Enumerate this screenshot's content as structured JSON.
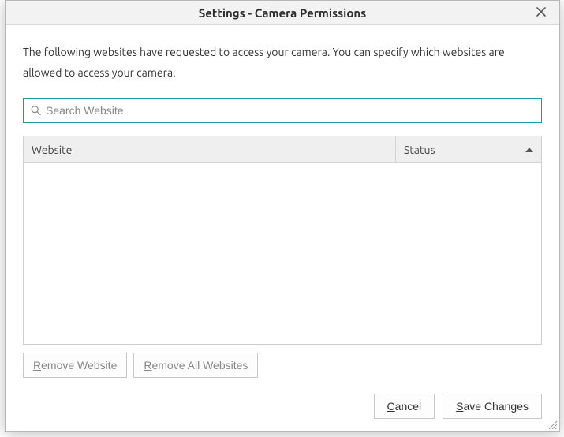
{
  "titlebar": {
    "title": "Settings - Camera Permissions",
    "close_name": "close-icon"
  },
  "description": "The following websites have requested to access your camera. You can specify which websites are allowed to access your camera.",
  "search": {
    "placeholder": "Search Website",
    "value": ""
  },
  "table": {
    "columns": {
      "website": "Website",
      "status": "Status"
    },
    "sort": {
      "column": "status",
      "dir": "asc"
    },
    "rows": []
  },
  "rowActions": {
    "remove": {
      "prefix": "R",
      "rest": "emove Website"
    },
    "removeAll": {
      "prefix": "R",
      "rest": "emove All Websites"
    }
  },
  "footer": {
    "cancel": {
      "prefix": "C",
      "rest": "ancel"
    },
    "save": {
      "prefix": "S",
      "rest": "ave Changes"
    }
  }
}
